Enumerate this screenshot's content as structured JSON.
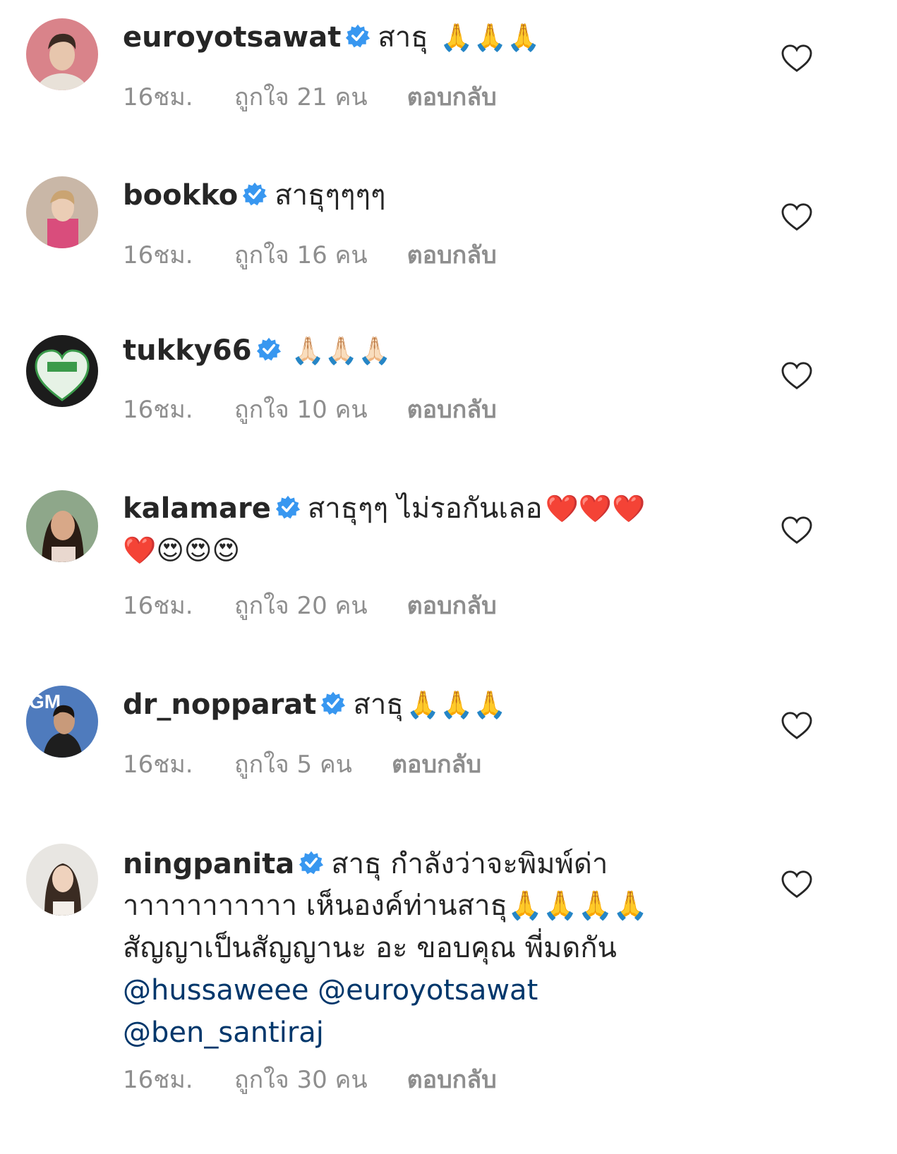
{
  "colors": {
    "username": "#262626",
    "meta": "#8e8e8e",
    "mention": "#00376b",
    "verified": "#3897f0"
  },
  "icons": {
    "verified": "verified-badge-icon",
    "like": "heart-outline-icon"
  },
  "comments": [
    {
      "username": "euroyotsawat",
      "text": "สาธุ",
      "emoji": "🙏🙏🙏",
      "time": "16ชม.",
      "likes": "ถูกใจ 21 คน",
      "reply": "ตอบกลับ"
    },
    {
      "username": "bookko",
      "text": "สาธุๆๆๆๆ",
      "emoji": "",
      "time": "16ชม.",
      "likes": "ถูกใจ 16 คน",
      "reply": "ตอบกลับ"
    },
    {
      "username": "tukky66",
      "text": "",
      "emoji": "🙏🏻🙏🏻🙏🏻",
      "time": "16ชม.",
      "likes": "ถูกใจ 10 คน",
      "reply": "ตอบกลับ"
    },
    {
      "username": "kalamare",
      "text": "สาธุๆๆ ไม่รอกันเลอ",
      "emoji": "❤️❤️❤️",
      "line2": "❤️😍😍😍",
      "time": "16ชม.",
      "likes": "ถูกใจ 20 คน",
      "reply": "ตอบกลับ"
    },
    {
      "username": "dr_nopparat",
      "text": "สาธุ",
      "emoji": "🙏🙏🙏",
      "time": "16ชม.",
      "likes": "ถูกใจ 5 คน",
      "reply": "ตอบกลับ"
    },
    {
      "username": "ningpanita",
      "text": "สาธุ กำลังว่าจะพิมพ์ด่า",
      "line2": "าาาาาาาาาาา เห็นองค์ท่านสาธุ🙏🙏🙏🙏",
      "line3": "สัญญาเป็นสัญญานะ อะ ขอบคุณ พี่มดกัน",
      "mentions": [
        "@hussaweee",
        "@euroyotsawat",
        "@ben_santiraj"
      ],
      "time": "16ชม.",
      "likes": "ถูกใจ 30 คน",
      "reply": "ตอบกลับ"
    }
  ]
}
